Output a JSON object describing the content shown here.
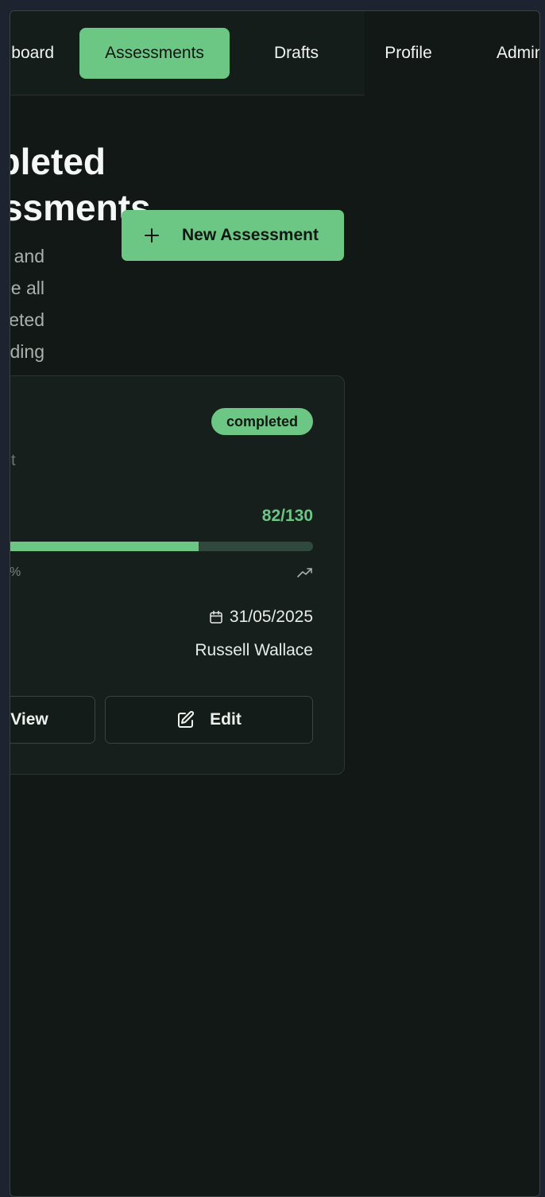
{
  "nav": {
    "items": [
      {
        "label": "Dashboard",
        "active": false
      },
      {
        "label": "Assessments",
        "active": true
      },
      {
        "label": "Drafts",
        "active": false
      },
      {
        "label": "Profile",
        "active": false
      },
      {
        "label": "Admin",
        "active": false
      }
    ]
  },
  "header": {
    "title": "Completed Assessments",
    "title_line1": "Completed",
    "title_line2": "Assessments",
    "subtitle_line1": "View and manage all",
    "subtitle_line2": "your completed grading"
  },
  "new_button": {
    "label": "New Assessment",
    "icon": "plus-icon"
  },
  "card": {
    "status": "completed",
    "score": "82/130",
    "progress": 0.63,
    "date": "31/05/2025",
    "author": "Russell Wallace",
    "view_label": "View",
    "edit_label": "Edit",
    "icons": [
      "calendar-icon",
      "edit-icon",
      "trend-up-icon"
    ]
  },
  "colors": {
    "accent": "#6cc684",
    "background": "#111815",
    "card": "#161f1c"
  }
}
